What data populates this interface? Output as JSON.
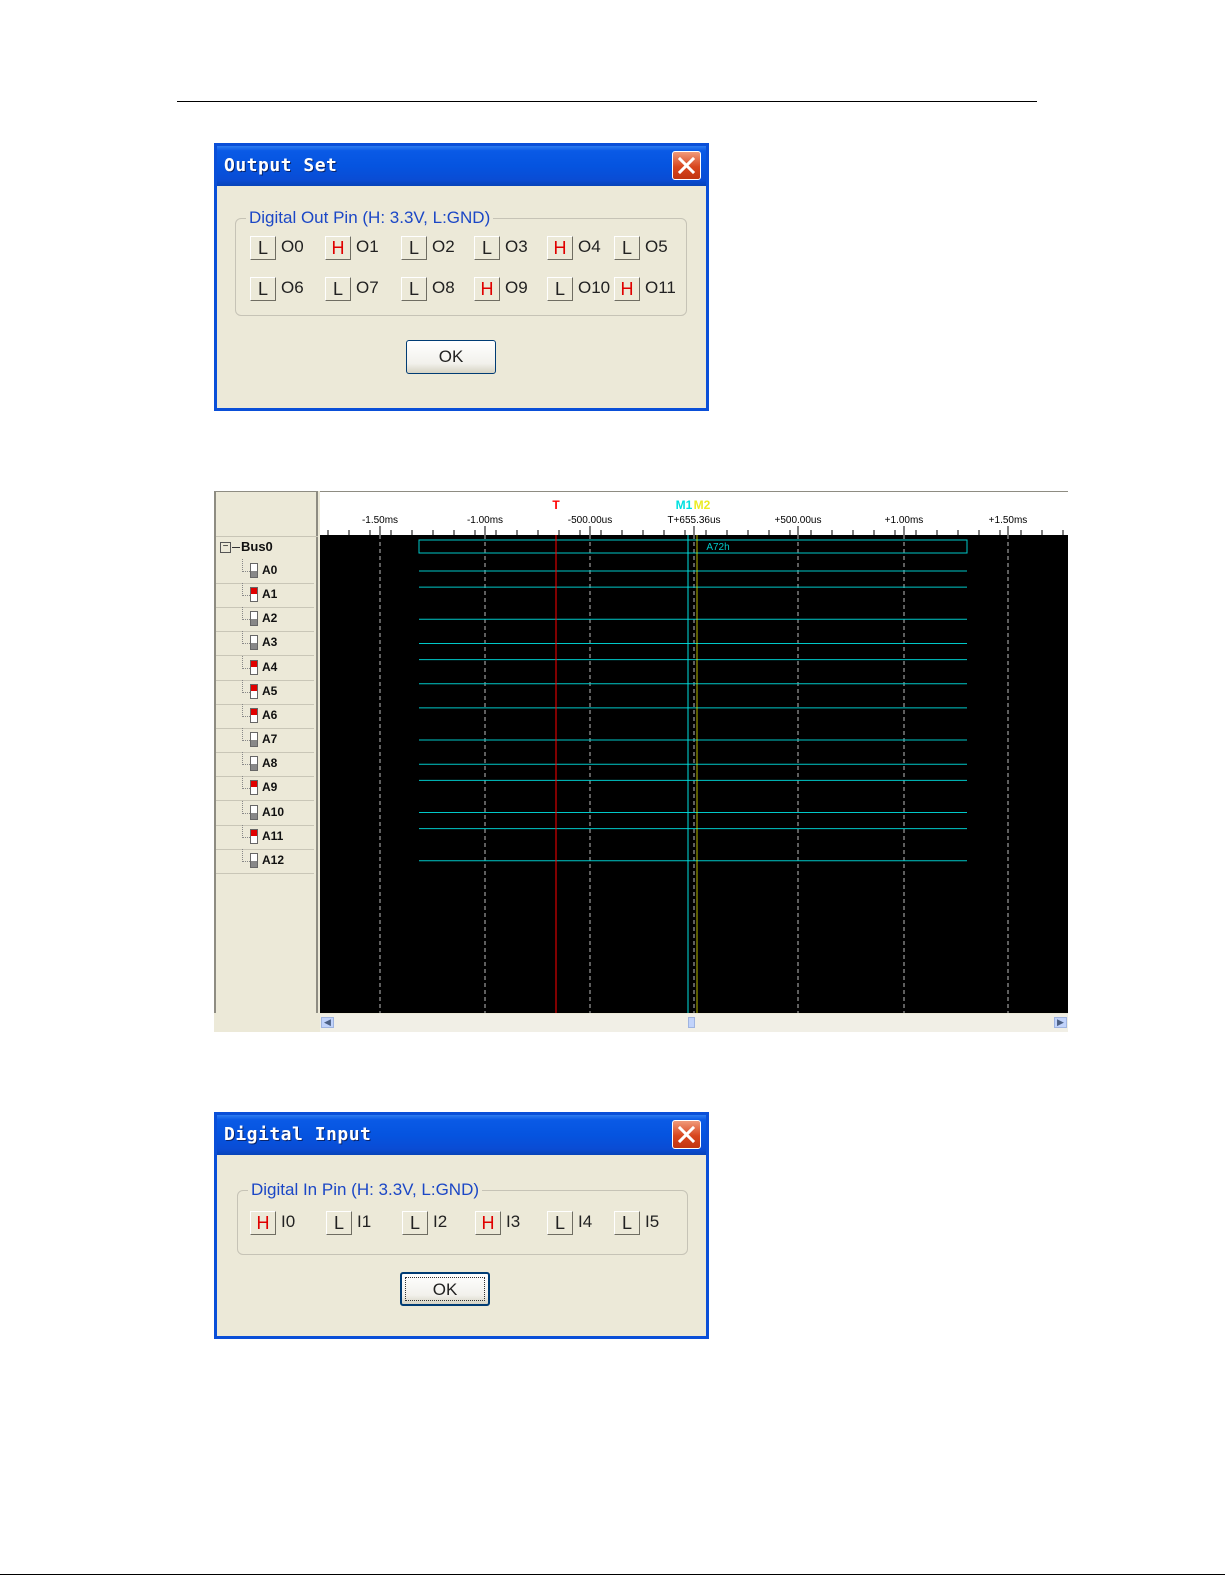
{
  "output_dialog": {
    "title": "Output Set",
    "group_label": "Digital Out Pin (H: 3.3V, L:GND)",
    "pins": [
      {
        "state": "L",
        "name": "O0"
      },
      {
        "state": "H",
        "name": "O1"
      },
      {
        "state": "L",
        "name": "O2"
      },
      {
        "state": "L",
        "name": "O3"
      },
      {
        "state": "H",
        "name": "O4"
      },
      {
        "state": "L",
        "name": "O5"
      },
      {
        "state": "L",
        "name": "O6"
      },
      {
        "state": "L",
        "name": "O7"
      },
      {
        "state": "L",
        "name": "O8"
      },
      {
        "state": "H",
        "name": "O9"
      },
      {
        "state": "L",
        "name": "O10"
      },
      {
        "state": "H",
        "name": "O11"
      }
    ],
    "ok_label": "OK"
  },
  "analyzer": {
    "bus_name": "Bus0",
    "channels": [
      {
        "name": "A0",
        "level": "L"
      },
      {
        "name": "A1",
        "level": "H"
      },
      {
        "name": "A2",
        "level": "L"
      },
      {
        "name": "A3",
        "level": "L"
      },
      {
        "name": "A4",
        "level": "H"
      },
      {
        "name": "A5",
        "level": "H"
      },
      {
        "name": "A6",
        "level": "H"
      },
      {
        "name": "A7",
        "level": "L"
      },
      {
        "name": "A8",
        "level": "L"
      },
      {
        "name": "A9",
        "level": "H"
      },
      {
        "name": "A10",
        "level": "L"
      },
      {
        "name": "A11",
        "level": "H"
      },
      {
        "name": "A12",
        "level": "L"
      }
    ],
    "bus_value": "A72h",
    "trigger_marker": "T",
    "marker_label_1": "M1",
    "marker_label_2": "M2",
    "tick_labels": [
      "-1.50ms",
      "-1.00ms",
      "-500.00us",
      "T+655.36us",
      "+500.00us",
      "+1.00ms",
      "+1.50ms"
    ],
    "colors": {
      "trace": "#00c8c8",
      "trigger": "#ff0000",
      "marker1": "#00e0e0",
      "marker2": "#e8e800",
      "plot_bg": "#000000"
    }
  },
  "input_dialog": {
    "title": "Digital Input",
    "group_label": "Digital In Pin (H: 3.3V, L:GND)",
    "pins": [
      {
        "state": "H",
        "name": "I0"
      },
      {
        "state": "L",
        "name": "I1"
      },
      {
        "state": "L",
        "name": "I2"
      },
      {
        "state": "H",
        "name": "I3"
      },
      {
        "state": "L",
        "name": "I4"
      },
      {
        "state": "L",
        "name": "I5"
      }
    ],
    "ok_label": "OK"
  }
}
